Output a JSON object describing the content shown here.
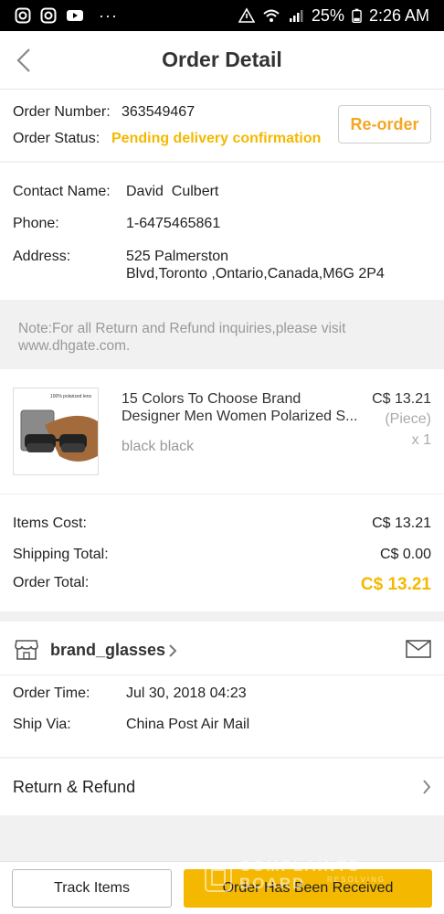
{
  "statusbar": {
    "battery": "25%",
    "time": "2:26 AM",
    "dots": "···"
  },
  "header": {
    "title": "Order Detail"
  },
  "order": {
    "number_label": "Order Number:",
    "number": "363549467",
    "status_label": "Order Status:",
    "status": "Pending delivery confirmation",
    "reorder_label": "Re-order"
  },
  "contact": {
    "name_label": "Contact Name:",
    "name": "David  Culbert",
    "phone_label": "Phone:",
    "phone": "1-6475465861",
    "address_label": "Address:",
    "address_line1": "525 Palmerston",
    "address_line2": "Blvd,Toronto ,Ontario,Canada,M6G 2P4"
  },
  "note": {
    "line1": "Note:For all Return and Refund inquiries,please visit",
    "line2": "www.dhgate.com."
  },
  "product": {
    "thumb_caption": "100% polarized lens",
    "title_line1": "15 Colors To Choose Brand",
    "title_line2": "Designer Men Women Polarized S...",
    "variant": "black black",
    "price": "C$ 13.21",
    "unit": "(Piece)",
    "qty": "x 1"
  },
  "costs": {
    "items_label": "Items Cost:",
    "items_value": "C$ 13.21",
    "shipping_label": "Shipping Total:",
    "shipping_value": "C$ 0.00",
    "total_label": "Order Total:",
    "total_value": "C$ 13.21"
  },
  "store": {
    "name": "brand_glasses",
    "order_time_label": "Order Time:",
    "order_time": "Jul 30, 2018 04:23",
    "ship_via_label": "Ship Via:",
    "ship_via": "China Post Air Mail"
  },
  "refund": {
    "label": "Return & Refund"
  },
  "bottom": {
    "track_label": "Track Items",
    "received_label": "Order Has Been Received"
  },
  "watermark": {
    "line1": "COMPLAINTS",
    "line2": "BOARD",
    "line3": "RESOLVING"
  },
  "colors": {
    "accent": "#f5b800",
    "reorder_text": "#f5a623",
    "note_text": "#999999"
  },
  "icons": [
    "instagram-icon",
    "instagram-icon",
    "youtube-icon",
    "alert-icon",
    "wifi-icon",
    "signal-icon",
    "battery-icon",
    "back-chevron-icon",
    "store-icon",
    "chevron-right-icon",
    "mail-icon"
  ]
}
